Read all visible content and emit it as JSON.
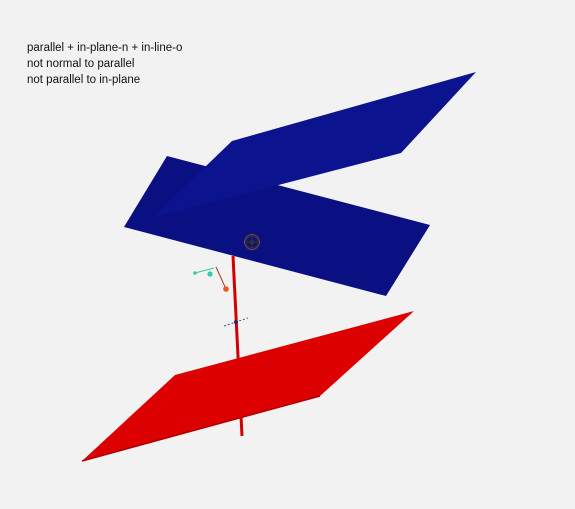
{
  "overlay": {
    "lines": [
      "parallel + in-plane-n + in-line-o",
      "not normal to parallel",
      "not parallel to in-plane"
    ]
  },
  "scene": {
    "background_color": "#f2f2f2",
    "colors": {
      "blue_plane": "#0a0f82",
      "blue_plane_lit": "#0c138f",
      "red_plane": "#dc0000",
      "red_plane_edge": "#b00000",
      "axis_line": "#d40000",
      "teal_marker": "#36c9a6",
      "orange_marker": "#ee5a1e",
      "gizmo": "#303030"
    },
    "icons": [
      "axis-gizmo-icon",
      "origin-marker-icon"
    ]
  }
}
